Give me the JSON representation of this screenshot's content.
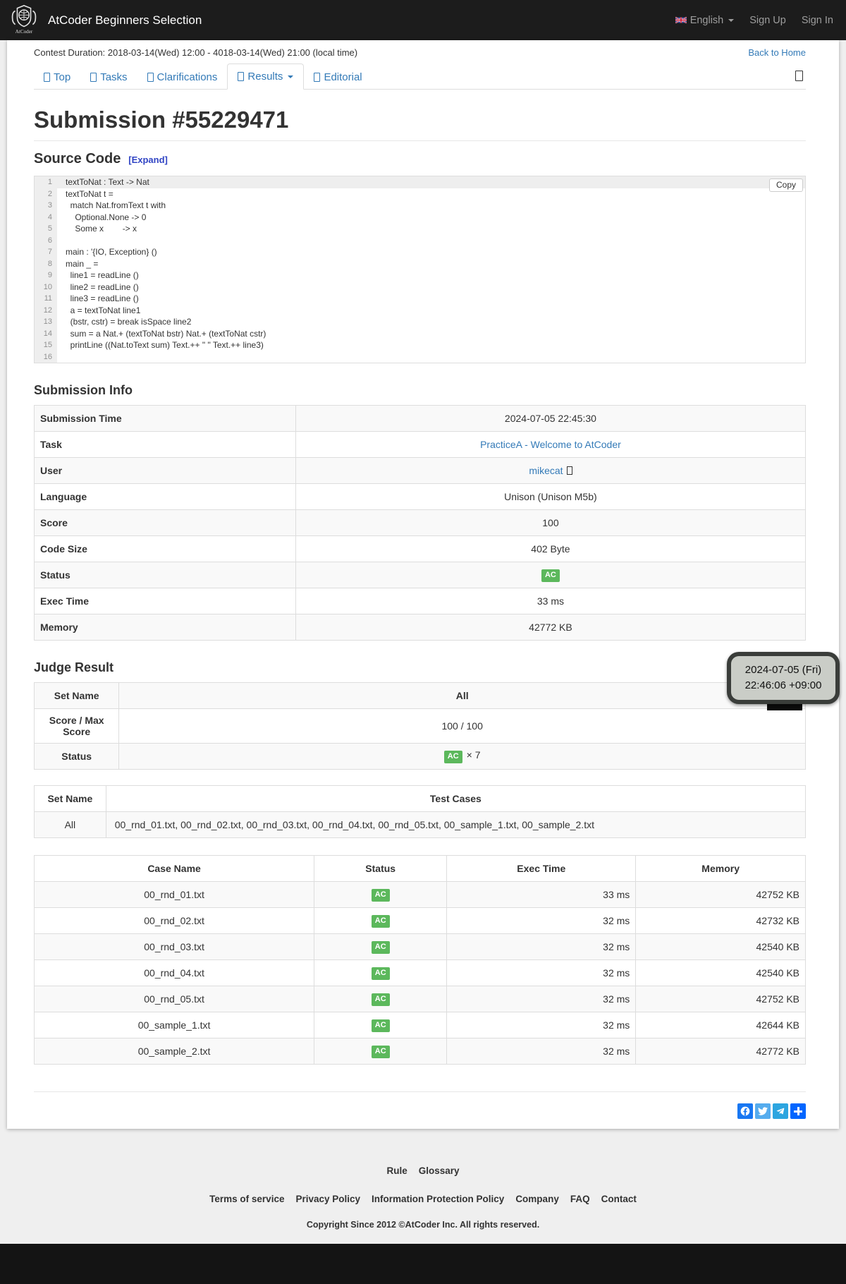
{
  "navbar": {
    "brand": "AtCoder Beginners Selection",
    "language": "English",
    "sign_up": "Sign Up",
    "sign_in": "Sign In"
  },
  "contest_bar": {
    "duration": "Contest Duration: 2018-03-14(Wed) 12:00 - 4018-03-14(Wed) 21:00 (local time)",
    "back_to_home": "Back to Home"
  },
  "tabs": [
    {
      "id": "top",
      "label": "Top",
      "active": false,
      "dropdown": false
    },
    {
      "id": "tasks",
      "label": "Tasks",
      "active": false,
      "dropdown": false
    },
    {
      "id": "clarifications",
      "label": "Clarifications",
      "active": false,
      "dropdown": false
    },
    {
      "id": "results",
      "label": "Results",
      "active": true,
      "dropdown": true
    },
    {
      "id": "editorial",
      "label": "Editorial",
      "active": false,
      "dropdown": false
    }
  ],
  "page_title": "Submission #55229471",
  "source_code": {
    "heading": "Source Code",
    "expand_label": "[Expand]",
    "copy_label": "Copy",
    "lines": [
      "textToNat : Text -> Nat",
      "textToNat t =",
      "  match Nat.fromText t with",
      "    Optional.None -> 0",
      "    Some x        -> x",
      "",
      "main : '{IO, Exception} ()",
      "main _ =",
      "  line1 = readLine ()",
      "  line2 = readLine ()",
      "  line3 = readLine ()",
      "  a = textToNat line1",
      "  (bstr, cstr) = break isSpace line2",
      "  sum = a Nat.+ (textToNat bstr) Nat.+ (textToNat cstr)",
      "  printLine ((Nat.toText sum) Text.++ \" \" Text.++ line3)",
      ""
    ]
  },
  "submission_info": {
    "heading": "Submission Info",
    "rows": [
      {
        "key": "submission-time",
        "label": "Submission Time",
        "value": "2024-07-05 22:45:30",
        "kind": "text"
      },
      {
        "key": "task",
        "label": "Task",
        "value": "PracticeA - Welcome to AtCoder",
        "kind": "link"
      },
      {
        "key": "user",
        "label": "User",
        "value": "mikecat",
        "kind": "user"
      },
      {
        "key": "language",
        "label": "Language",
        "value": "Unison (Unison M5b)",
        "kind": "text"
      },
      {
        "key": "score",
        "label": "Score",
        "value": "100",
        "kind": "text"
      },
      {
        "key": "code-size",
        "label": "Code Size",
        "value": "402 Byte",
        "kind": "text"
      },
      {
        "key": "status",
        "label": "Status",
        "value": "AC",
        "kind": "badge"
      },
      {
        "key": "exec-time",
        "label": "Exec Time",
        "value": "33 ms",
        "kind": "text"
      },
      {
        "key": "memory",
        "label": "Memory",
        "value": "42772 KB",
        "kind": "text"
      }
    ]
  },
  "judge_result": {
    "heading": "Judge Result",
    "summary": {
      "set_name_label": "Set Name",
      "set_name_value": "All",
      "score_label": "Score / Max Score",
      "score_value": "100 / 100",
      "status_label": "Status",
      "status_badge": "AC",
      "status_multiplier": "× 7"
    },
    "sets": {
      "headers": [
        "Set Name",
        "Test Cases"
      ],
      "rows": [
        {
          "set": "All",
          "cases": "00_rnd_01.txt, 00_rnd_02.txt, 00_rnd_03.txt, 00_rnd_04.txt, 00_rnd_05.txt, 00_sample_1.txt, 00_sample_2.txt"
        }
      ]
    },
    "cases": {
      "headers": [
        "Case Name",
        "Status",
        "Exec Time",
        "Memory"
      ],
      "rows": [
        {
          "name": "00_rnd_01.txt",
          "status": "AC",
          "time": "33 ms",
          "memory": "42752 KB"
        },
        {
          "name": "00_rnd_02.txt",
          "status": "AC",
          "time": "32 ms",
          "memory": "42732 KB"
        },
        {
          "name": "00_rnd_03.txt",
          "status": "AC",
          "time": "32 ms",
          "memory": "42540 KB"
        },
        {
          "name": "00_rnd_04.txt",
          "status": "AC",
          "time": "32 ms",
          "memory": "42540 KB"
        },
        {
          "name": "00_rnd_05.txt",
          "status": "AC",
          "time": "32 ms",
          "memory": "42752 KB"
        },
        {
          "name": "00_sample_1.txt",
          "status": "AC",
          "time": "32 ms",
          "memory": "42644 KB"
        },
        {
          "name": "00_sample_2.txt",
          "status": "AC",
          "time": "32 ms",
          "memory": "42772 KB"
        }
      ]
    }
  },
  "tooltip": {
    "line1": "2024-07-05 (Fri)",
    "line2": "22:46:06 +09:00"
  },
  "share": {
    "icons": [
      "facebook",
      "twitter",
      "telegram",
      "share-plus"
    ]
  },
  "footer": {
    "row1": [
      "Rule",
      "Glossary"
    ],
    "row2": [
      "Terms of service",
      "Privacy Policy",
      "Information Protection Policy",
      "Company",
      "FAQ",
      "Contact"
    ],
    "copyright_prefix": "Copyright Since 2012 ©",
    "copyright_strong": "AtCoder Inc.",
    "copyright_suffix": " All rights reserved."
  },
  "colors": {
    "accent_blue": "#337ab7",
    "badge_green": "#5cb85c",
    "navbar_bg": "#1c1c1c"
  }
}
